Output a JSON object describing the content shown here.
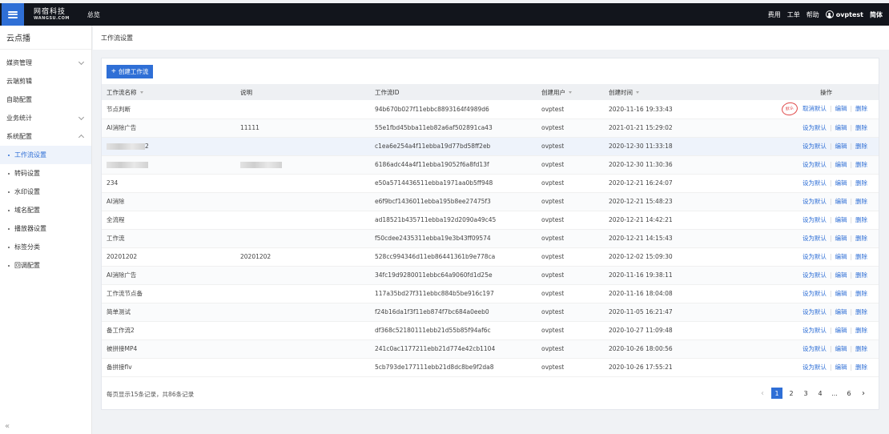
{
  "topbar": {
    "logo_cn": "网宿科技",
    "logo_en": "WANGSU.COM",
    "overview": "总览",
    "links": [
      "费用",
      "工单",
      "帮助"
    ],
    "username": "ovptest",
    "language": "简体"
  },
  "sidebar": {
    "title": "云点播",
    "items": [
      {
        "label": "媒资管理",
        "expandable": true
      },
      {
        "label": "云端剪辑",
        "expandable": false
      },
      {
        "label": "自助配置",
        "expandable": false
      },
      {
        "label": "业务统计",
        "expandable": true
      },
      {
        "label": "系统配置",
        "expandable": true
      }
    ],
    "sub_items": [
      {
        "label": "工作流设置",
        "active": true
      },
      {
        "label": "转码设置"
      },
      {
        "label": "水印设置"
      },
      {
        "label": "域名配置"
      },
      {
        "label": "播放器设置"
      },
      {
        "label": "标签分类"
      },
      {
        "label": "回调配置"
      }
    ],
    "collapse_icon": "«"
  },
  "breadcrumb": "工作流设置",
  "create_button": "创建工作流",
  "table": {
    "columns": [
      "工作流名称",
      "说明",
      "工作流ID",
      "创建用户",
      "创建时间",
      "操作"
    ],
    "default_stamp": "默认",
    "actions": {
      "set_default": "设为默认",
      "cancel_default": "取消默认",
      "edit": "编辑",
      "delete": "删除"
    },
    "rows": [
      {
        "name": "节点判断",
        "desc": "",
        "id": "94b670b027f11ebbc8893164f4989d6",
        "user": "ovptest",
        "time": "2020-11-16 19:33:43",
        "is_default": true
      },
      {
        "name": "AI消除广告",
        "desc": "11111",
        "id": "55e1fbd45bba11eb82a6af502891ca43",
        "user": "ovptest",
        "time": "2021-01-21 15:29:02"
      },
      {
        "name": "2",
        "desc": "",
        "id": "c1ea6e254a4f11ebba19d77bd58ff2eb",
        "user": "ovptest",
        "time": "2020-12-30 11:33:18",
        "blur_name": true,
        "highlight": true
      },
      {
        "name": "",
        "desc": "",
        "id": "6186adc44a4f11ebba19052f6a8fd13f",
        "user": "ovptest",
        "time": "2020-12-30 11:30:36",
        "blur_name": true,
        "blur_desc": true
      },
      {
        "name": "234",
        "desc": "",
        "id": "e50a5714436511ebba1971aa0b5ff948",
        "user": "ovptest",
        "time": "2020-12-21 16:24:07"
      },
      {
        "name": "AI消除",
        "desc": "",
        "id": "e6f9bcf1436011ebba195b8ee27475f3",
        "user": "ovptest",
        "time": "2020-12-21 15:48:23"
      },
      {
        "name": "全流程",
        "desc": "",
        "id": "ad18521b435711ebba192d2090a49c45",
        "user": "ovptest",
        "time": "2020-12-21 14:42:21"
      },
      {
        "name": "工作流",
        "desc": "",
        "id": "f50cdee2435311ebba19e3b43ff09574",
        "user": "ovptest",
        "time": "2020-12-21 14:15:43"
      },
      {
        "name": "20201202",
        "desc": "20201202",
        "id": "528cc994346d11eb86441361b9e778ca",
        "user": "ovptest",
        "time": "2020-12-02 15:09:30"
      },
      {
        "name": "AI消除广告",
        "desc": "",
        "id": "34fc19d9280011ebbc64a9060fd1d25e",
        "user": "ovptest",
        "time": "2020-11-16 19:38:11"
      },
      {
        "name": "工作流节点备",
        "desc": "",
        "id": "117a35bd27f311ebbc884b5be916c197",
        "user": "ovptest",
        "time": "2020-11-16 18:04:08"
      },
      {
        "name": "简单测试",
        "desc": "",
        "id": "f24b16da1f3f11eb874f7bc684a0eeb0",
        "user": "ovptest",
        "time": "2020-11-05 16:21:47"
      },
      {
        "name": "备工作流2",
        "desc": "",
        "id": "df368c52180111ebb21d55b85f94af6c",
        "user": "ovptest",
        "time": "2020-10-27 11:09:48"
      },
      {
        "name": "被拼接MP4",
        "desc": "",
        "id": "241c0ac1177211ebb21d774e42cb1104",
        "user": "ovptest",
        "time": "2020-10-26 18:00:56"
      },
      {
        "name": "备拼接flv",
        "desc": "",
        "id": "5cb793de177111ebb21d8dc8be9f2da8",
        "user": "ovptest",
        "time": "2020-10-26 17:55:21"
      }
    ]
  },
  "footer": {
    "info": "每页显示15条记录，共86条记录",
    "pages": [
      "1",
      "2",
      "3",
      "4",
      "...",
      "6"
    ],
    "current_page": "1",
    "prev": "‹",
    "next": "›"
  },
  "colors": {
    "primary": "#2f6fd6",
    "topbar": "#12151c",
    "stamp": "#e04a4a"
  }
}
